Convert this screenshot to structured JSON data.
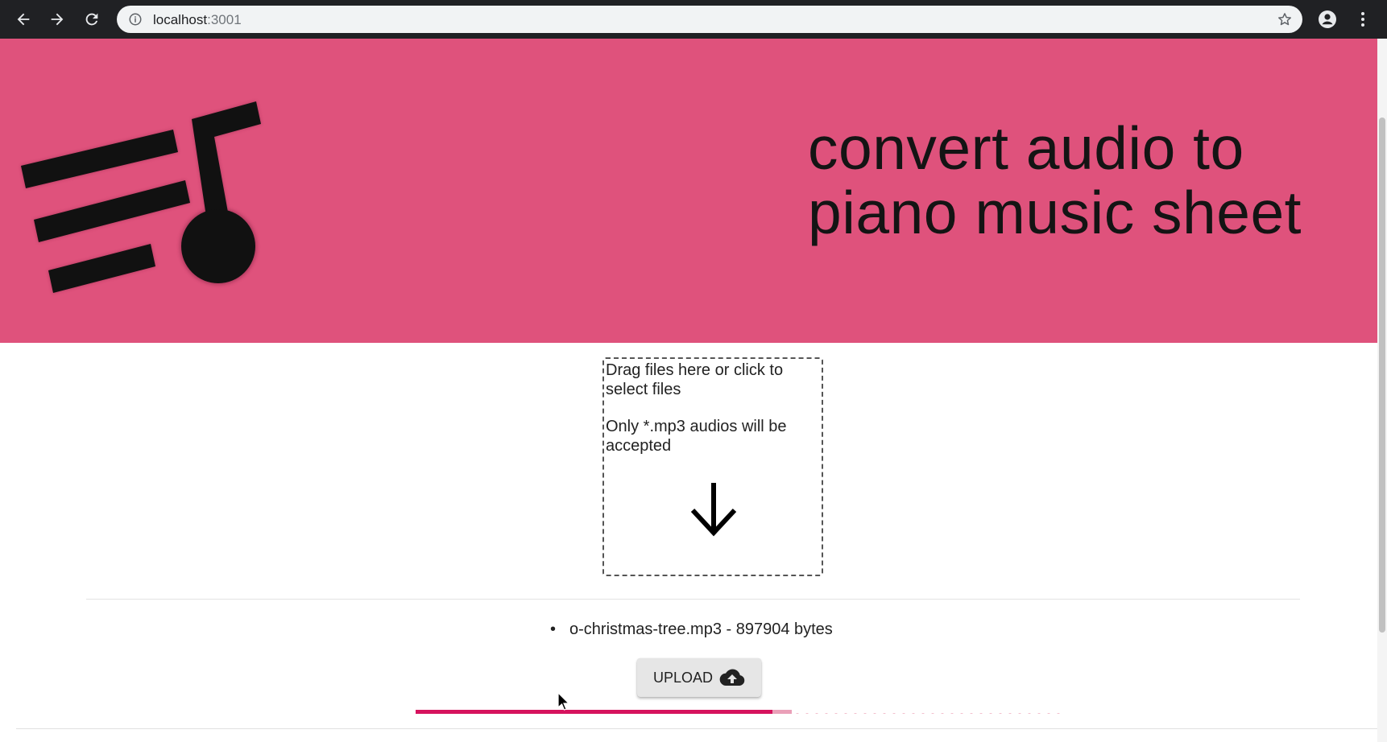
{
  "browser": {
    "url_host": "localhost",
    "url_port": ":3001"
  },
  "hero": {
    "title_line1": "convert audio to",
    "title_line2": "piano music sheet",
    "background_color": "#df527c"
  },
  "dropzone": {
    "instruction": "Drag files here or click to select files",
    "accept_note": "Only *.mp3 audios will be accepted",
    "icon": "arrow-down-icon"
  },
  "files": [
    {
      "label": "o-christmas-tree.mp3 - 897904 bytes"
    }
  ],
  "upload": {
    "label": "UPLOAD",
    "icon": "cloud-upload-icon"
  },
  "progress": {
    "value": 0.55,
    "buffer": 0.58,
    "color": "#d6135e"
  }
}
